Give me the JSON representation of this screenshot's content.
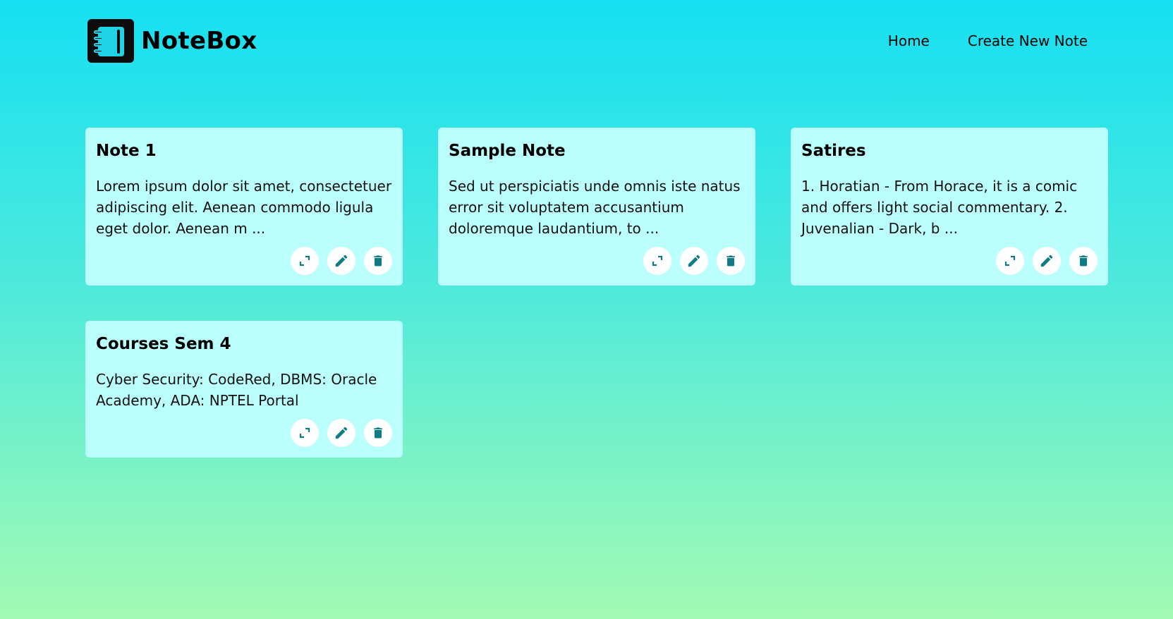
{
  "brand": {
    "name": "NoteBox",
    "logo_icon": "notebook-icon"
  },
  "nav": {
    "home_label": "Home",
    "create_label": "Create New Note"
  },
  "colors": {
    "accent": "#0e7b85",
    "card_background": "#bbfffc",
    "gradient_top": "#16e0f2",
    "gradient_bottom": "#a3fbb3"
  },
  "notes": [
    {
      "title": "Note 1",
      "excerpt": "Lorem ipsum dolor sit amet, consectetuer adipiscing elit. Aenean commodo ligula eget dolor. Aenean m ..."
    },
    {
      "title": "Sample Note",
      "excerpt": "Sed ut perspiciatis unde omnis iste natus error sit voluptatem accusantium doloremque laudantium, to ..."
    },
    {
      "title": "Satires",
      "excerpt": "1. Horatian - From Horace, it is a comic and offers light social commentary. 2. Juvenalian - Dark, b ..."
    },
    {
      "title": "Courses Sem 4",
      "excerpt": "Cyber Security: CodeRed, DBMS: Oracle Academy, ADA: NPTEL Portal"
    }
  ],
  "note_actions": [
    "expand-icon",
    "pencil-icon",
    "trash-icon"
  ]
}
